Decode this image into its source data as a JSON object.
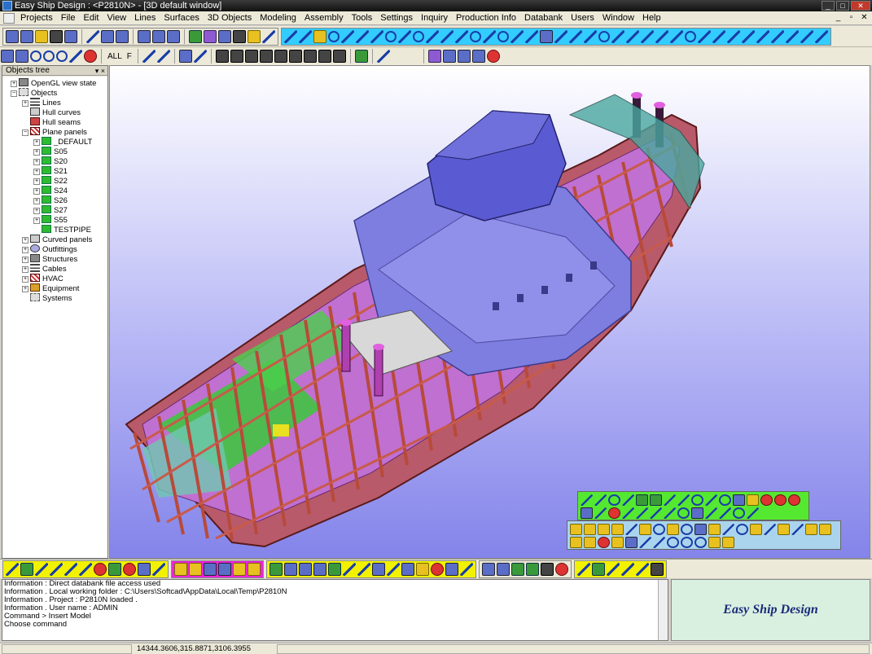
{
  "window": {
    "title": "Easy Ship Design : <P2810N> - [3D default window]"
  },
  "menu": [
    "Projects",
    "File",
    "Edit",
    "View",
    "Lines",
    "Surfaces",
    "3D Objects",
    "Modeling",
    "Assembly",
    "Tools",
    "Settings",
    "Inquiry",
    "Production Info",
    "Databank",
    "Users",
    "Window",
    "Help"
  ],
  "toolbar2": {
    "all_label": "ALL",
    "fit_label": "F"
  },
  "tree": {
    "header": "Objects tree",
    "items": [
      {
        "label": "OpenGL view state"
      },
      {
        "label": "Objects"
      },
      {
        "label": "Lines"
      },
      {
        "label": "Hull curves"
      },
      {
        "label": "Hull seams"
      },
      {
        "label": "Plane panels"
      },
      {
        "label": "_DEFAULT"
      },
      {
        "label": "S05"
      },
      {
        "label": "S20"
      },
      {
        "label": "S21"
      },
      {
        "label": "S22"
      },
      {
        "label": "S24"
      },
      {
        "label": "S26"
      },
      {
        "label": "S27"
      },
      {
        "label": "S55"
      },
      {
        "label": "TESTPIPE"
      },
      {
        "label": "Curved panels"
      },
      {
        "label": "Outfittings"
      },
      {
        "label": "Structures"
      },
      {
        "label": "Cables"
      },
      {
        "label": "HVAC"
      },
      {
        "label": "Equipment"
      },
      {
        "label": "Systems"
      }
    ]
  },
  "console": {
    "lines": [
      "Information : Direct databank file access used",
      "Information . Local working folder : C:\\Users\\Softcad\\AppData\\Local\\Temp\\P2810N",
      "Information . Project : P2810N loaded .",
      "Information . User name : ADMIN",
      "Command > Insert Model",
      "Choose command"
    ]
  },
  "brand": "Easy Ship Design",
  "status": {
    "coordinates": "14344.3606,315.8871,3106.3955"
  },
  "colors": {
    "viewport_top": "#ffffff",
    "viewport_bottom": "#8484ea",
    "hull_frame": "#b84a3a",
    "superstructure": "#6a6ad8",
    "deck": "#c070d0"
  }
}
